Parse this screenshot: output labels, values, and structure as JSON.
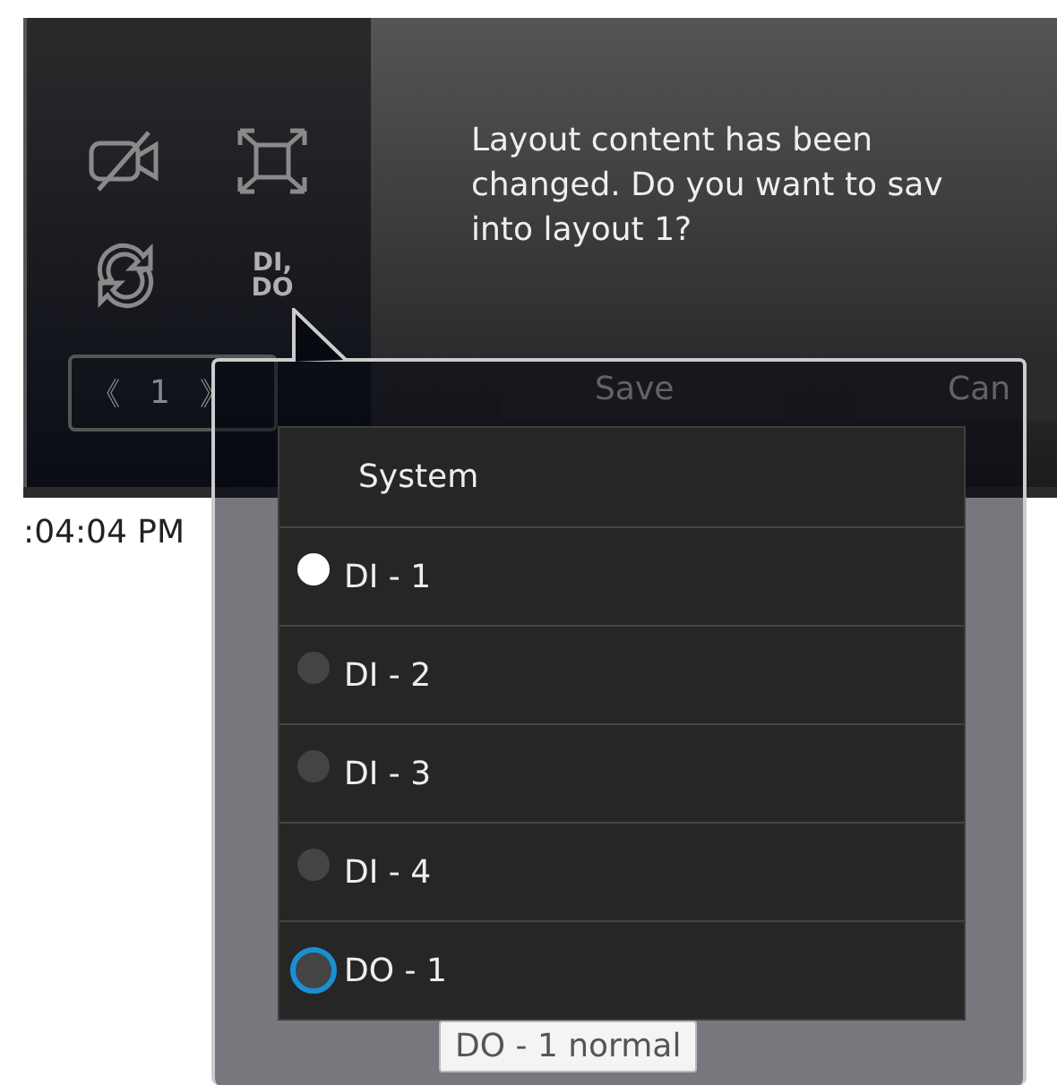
{
  "toolbar": {
    "icons": [
      {
        "kind": "camera-off"
      },
      {
        "kind": "fullscreen"
      },
      {
        "kind": "refresh"
      },
      {
        "kind": "text",
        "label": "DI, DO"
      }
    ],
    "pager": {
      "prev": "《",
      "page": "1",
      "next": "》"
    }
  },
  "dialog": {
    "message_lines": [
      "Layout content has been",
      "changed. Do you want to sav",
      "into layout 1?"
    ],
    "buttons": [
      "Save",
      "Can"
    ]
  },
  "timestamp": ":04:04 PM",
  "io_popup": {
    "header": "System",
    "items": [
      {
        "label": "DI - 1",
        "on": true,
        "selected": false
      },
      {
        "label": "DI - 2",
        "on": false,
        "selected": false
      },
      {
        "label": "DI - 3",
        "on": false,
        "selected": false
      },
      {
        "label": "DI - 4",
        "on": false,
        "selected": false
      },
      {
        "label": "DO - 1",
        "on": false,
        "selected": true
      }
    ]
  },
  "tooltip": "DO - 1 normal"
}
